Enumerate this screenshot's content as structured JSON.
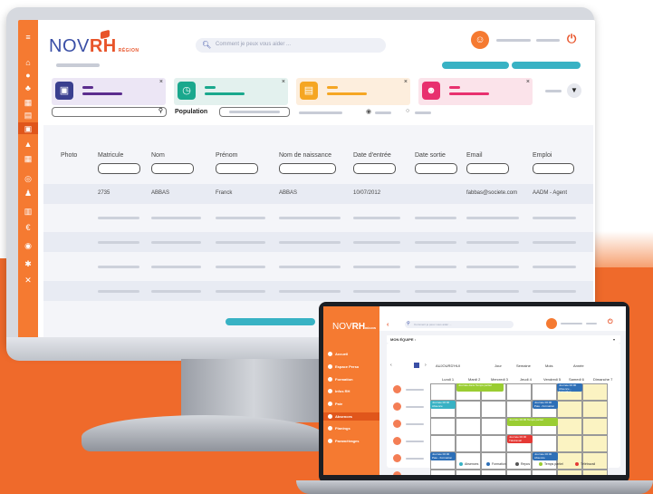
{
  "desktop": {
    "logo": {
      "main": "NOV",
      "accent": "RH",
      "suffix": "RÉGION"
    },
    "search_placeholder": "Comment je peux vous aider ...",
    "population_label": "Population",
    "columns": [
      "Photo",
      "Matricule",
      "Nom",
      "Prénom",
      "Nom de naissance",
      "Date d'entrée",
      "Date sortie",
      "Email",
      "Emploi"
    ],
    "rows": [
      {
        "matricule": "2735",
        "nom": "ABBAS",
        "prenom": "Franck",
        "nom_naissance": "ABBAS",
        "date_entree": "10/07/2012",
        "date_sortie": "",
        "email": "fabbas@societe.com",
        "emploi": "AADM - Agent"
      }
    ],
    "sidebar_icons": [
      "menu-icon",
      "home-icon",
      "person-icon",
      "group-icon",
      "calendar-icon",
      "briefcase-icon",
      "chart-icon",
      "calendar-grid-icon",
      "gear-badge-icon",
      "team-icon",
      "building-icon",
      "euro-icon",
      "money-icon",
      "settings-icon",
      "tools-icon"
    ],
    "cards": [
      {
        "icon": "person-card-icon",
        "color": "#3a3f8f",
        "bg": "#ece6f5",
        "line": "#5b2d8e"
      },
      {
        "icon": "clock-icon",
        "color": "#1aa88d",
        "bg": "#e3f1ee",
        "line": "#1aa88d"
      },
      {
        "icon": "briefcase-icon",
        "color": "#f5a623",
        "bg": "#fdeedd",
        "line": "#f5a623"
      },
      {
        "icon": "people-icon",
        "color": "#e8306e",
        "bg": "#fbe3ea",
        "line": "#e8306e"
      }
    ]
  },
  "laptop": {
    "logo": {
      "main": "NOV",
      "accent": "RH",
      "suffix": "RÉGION"
    },
    "search_placeholder": "Comment je peux vous aider ...",
    "menu": [
      "Accueil",
      "Espace Perso",
      "Formation",
      "Infos RH",
      "Paie",
      "Absences",
      "Planings",
      "Paramétrages"
    ],
    "team_label": "MON ÉQUIPE :",
    "today_label": "AUJOURD'HUI",
    "view_tabs": [
      "Jour",
      "Semaine",
      "Mois",
      "Année"
    ],
    "days": [
      "Lundi 1",
      "Mardi 2",
      "Mercredi 3",
      "Jeudi 4",
      "Vendredi 5",
      "Samedi 6",
      "Dimanche 7"
    ],
    "events": [
      {
        "label": "Journée dans Temps partiel",
        "color": "#9acd32"
      },
      {
        "label": "Journée 00:00 Absence - Formation",
        "color": "#2d6fb7"
      },
      {
        "label": "Journée 00:00 Absence",
        "color": "#38b2c4"
      },
      {
        "label": "Journée 00:00 Paie - Formation",
        "color": "#2d6fb7"
      },
      {
        "label": "Journée 00:00 Temps partiel",
        "color": "#9acd32"
      },
      {
        "label": "Journée 00:00 Télétravail",
        "color": "#e53935"
      },
      {
        "label": "Journée 00:00 Paie - Formation",
        "color": "#2d6fb7"
      },
      {
        "label": "Journée 00:00 Absence",
        "color": "#2d6fb7"
      }
    ],
    "legend": [
      {
        "label": "Absences",
        "color": "#38b2c4"
      },
      {
        "label": "Formation",
        "color": "#2d6fb7"
      },
      {
        "label": "Repos",
        "color": "#555555"
      },
      {
        "label": "Temps partiel",
        "color": "#9acd32"
      },
      {
        "label": "Télétravail",
        "color": "#e53935"
      }
    ]
  }
}
